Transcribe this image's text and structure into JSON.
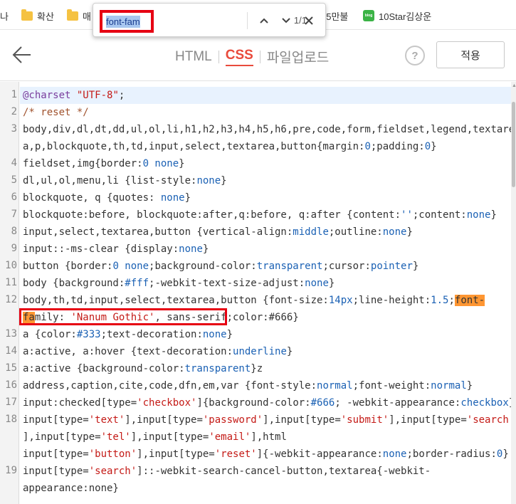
{
  "bookmarks": [
    {
      "label": "나",
      "icon": "none"
    },
    {
      "label": "확산",
      "icon": "folder-icon"
    },
    {
      "label": "매",
      "icon": "folder-icon"
    },
    {
      "label": "e5만불",
      "icon": "none"
    },
    {
      "label": "10Star김상운",
      "icon": "blog-icon"
    }
  ],
  "find": {
    "query": "font-fam",
    "count": "1/1"
  },
  "header": {
    "tabs": [
      {
        "label": "HTML",
        "active": false
      },
      {
        "label": "CSS",
        "active": true
      },
      {
        "label": "파일업로드",
        "active": false
      }
    ],
    "help": "?",
    "apply_label": "적용"
  },
  "code": {
    "line_numbers": [
      "1",
      "2",
      "3",
      "",
      "4",
      "5",
      "6",
      "7",
      "8",
      "9",
      "10",
      "11",
      "12",
      "",
      "13",
      "14",
      "15",
      "16",
      "17",
      "18",
      "",
      "",
      "19",
      ""
    ],
    "lines": [
      "@charset \"UTF-8\";",
      "/* reset */",
      "body,div,dl,dt,dd,ul,ol,li,h1,h2,h3,h4,h5,h6,pre,code,form,fieldset,legend,textare",
      "a,p,blockquote,th,td,input,select,textarea,button{margin:0;padding:0}",
      "fieldset,img{border:0 none}",
      "dl,ul,ol,menu,li {list-style:none}",
      "blockquote, q {quotes: none}",
      "blockquote:before, blockquote:after,q:before, q:after {content:'';content:none}",
      "input,select,textarea,button {vertical-align:middle;outline:none}",
      "input::-ms-clear {display:none}",
      "button {border:0 none;background-color:transparent;cursor:pointer}",
      "body {background:#fff;-webkit-text-size-adjust:none}",
      "body,th,td,input,select,textarea,button {font-size:14px;line-height:1.5;font-",
      "family: 'Nanum Gothic', sans-serif;color:#666}",
      "a {color:#333;text-decoration:none}",
      "a:active, a:hover {text-decoration:underline}",
      "a:active {background-color:transparent}z",
      "address,caption,cite,code,dfn,em,var {font-style:normal;font-weight:normal}",
      "input:checked[type='checkbox']{background-color:#666; -webkit-appearance:checkbox}",
      "input[type='text'],input[type='password'],input[type='submit'],input[type='search'",
      "],input[type='tel'],input[type='email'],html",
      "input[type='button'],input[type='reset']{-webkit-appearance:none;border-radius:0}",
      "input[type='search']::-webkit-search-cancel-button,textarea{-webkit-",
      "appearance:none}"
    ]
  },
  "colors": {
    "accent": "#e94b3c",
    "annotation": "#e60012",
    "match_highlight": "#ff9632"
  }
}
